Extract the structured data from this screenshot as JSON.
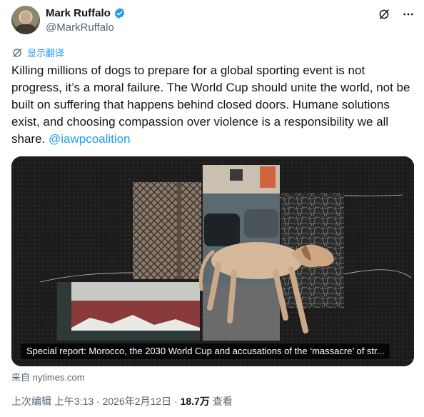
{
  "author": {
    "name": "Mark Ruffalo",
    "handle": "@MarkRuffalo",
    "verified": true
  },
  "header_icons": [
    "grok-icon",
    "more-icon"
  ],
  "translate": {
    "label": "显示翻译"
  },
  "tweet": {
    "text": "Killing millions of dogs to prepare for a global sporting event is not progress, it’s a moral failure. The World Cup should unite the world, not be built on suffering that happens behind closed doors. Humane solutions exist, and choosing compassion over violence is a responsibility we all share. ",
    "mention": "@iawpcoalition"
  },
  "card": {
    "caption": "Special report: Morocco, the 2030 World Cup and accusations of the ‘massacre’ of str...",
    "source_prefix": "来自",
    "source_domain": "nytimes.com"
  },
  "meta": {
    "edited_label": "上次编辑",
    "time": "上午3:13",
    "sep1": " · ",
    "date": "2026年2月12日",
    "sep2": " · ",
    "views_count": "18.7万",
    "views_label": "查看"
  },
  "colors": {
    "accent": "#1d9bf0",
    "text_primary": "#0f1419",
    "text_secondary": "#536471"
  }
}
